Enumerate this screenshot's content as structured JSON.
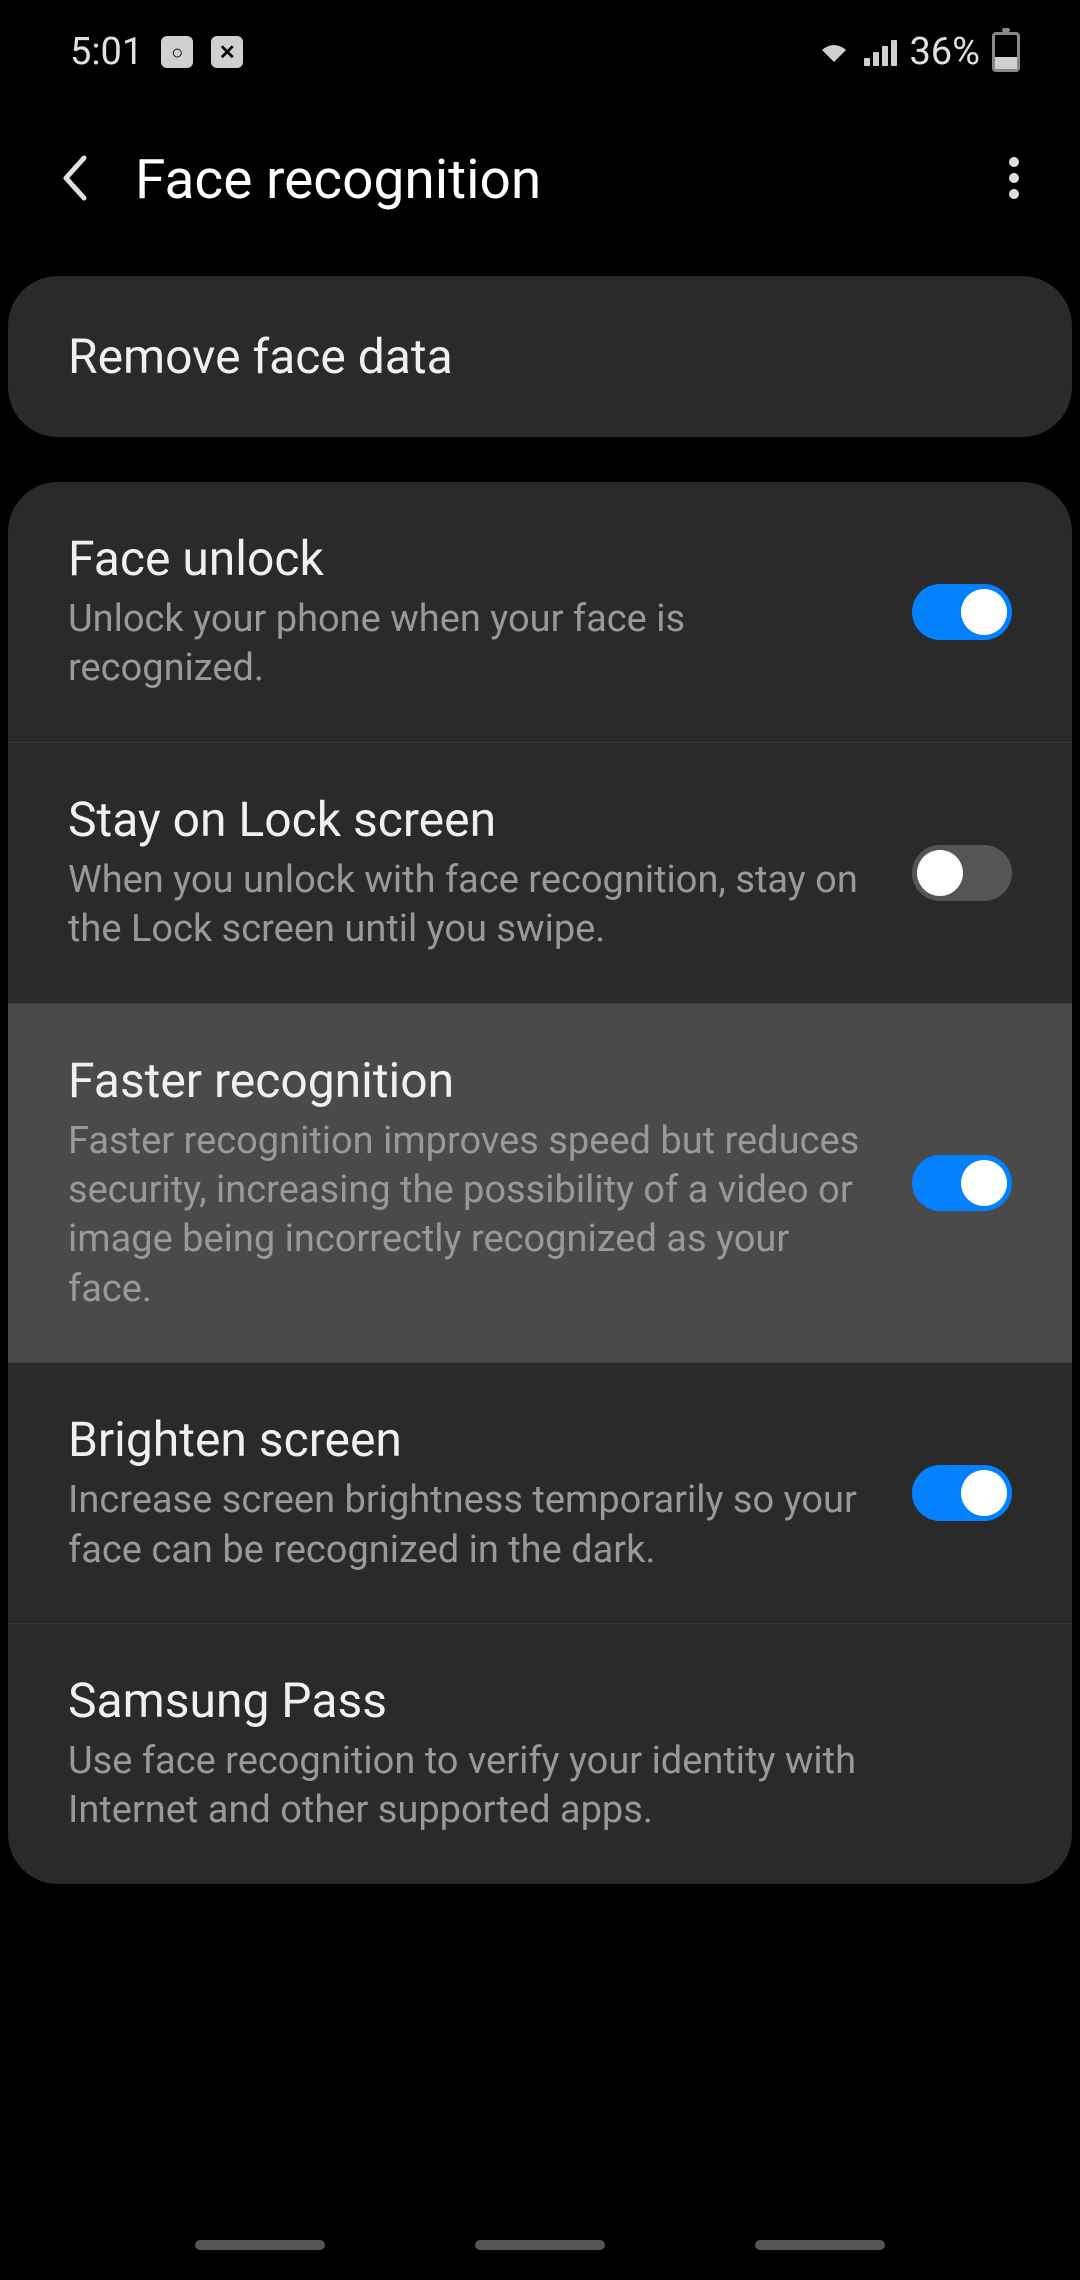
{
  "statusBar": {
    "time": "5:01",
    "battery": "36%"
  },
  "header": {
    "title": "Face recognition"
  },
  "removeCard": {
    "label": "Remove face data"
  },
  "settings": [
    {
      "title": "Face unlock",
      "desc": "Unlock your phone when your face is recognized.",
      "toggle": "on",
      "highlighted": false
    },
    {
      "title": "Stay on Lock screen",
      "desc": "When you unlock with face recognition, stay on the Lock screen until you swipe.",
      "toggle": "off",
      "highlighted": false
    },
    {
      "title": "Faster recognition",
      "desc": "Faster recognition improves speed but reduces security, increasing the possibility of a video or image being incorrectly recognized as your face.",
      "toggle": "on",
      "highlighted": true
    },
    {
      "title": "Brighten screen",
      "desc": "Increase screen brightness temporarily so your face can be recognized in the dark.",
      "toggle": "on",
      "highlighted": false
    },
    {
      "title": "Samsung Pass",
      "desc": "Use face recognition to verify your identity with Internet and other supported apps.",
      "toggle": null,
      "highlighted": false
    }
  ]
}
